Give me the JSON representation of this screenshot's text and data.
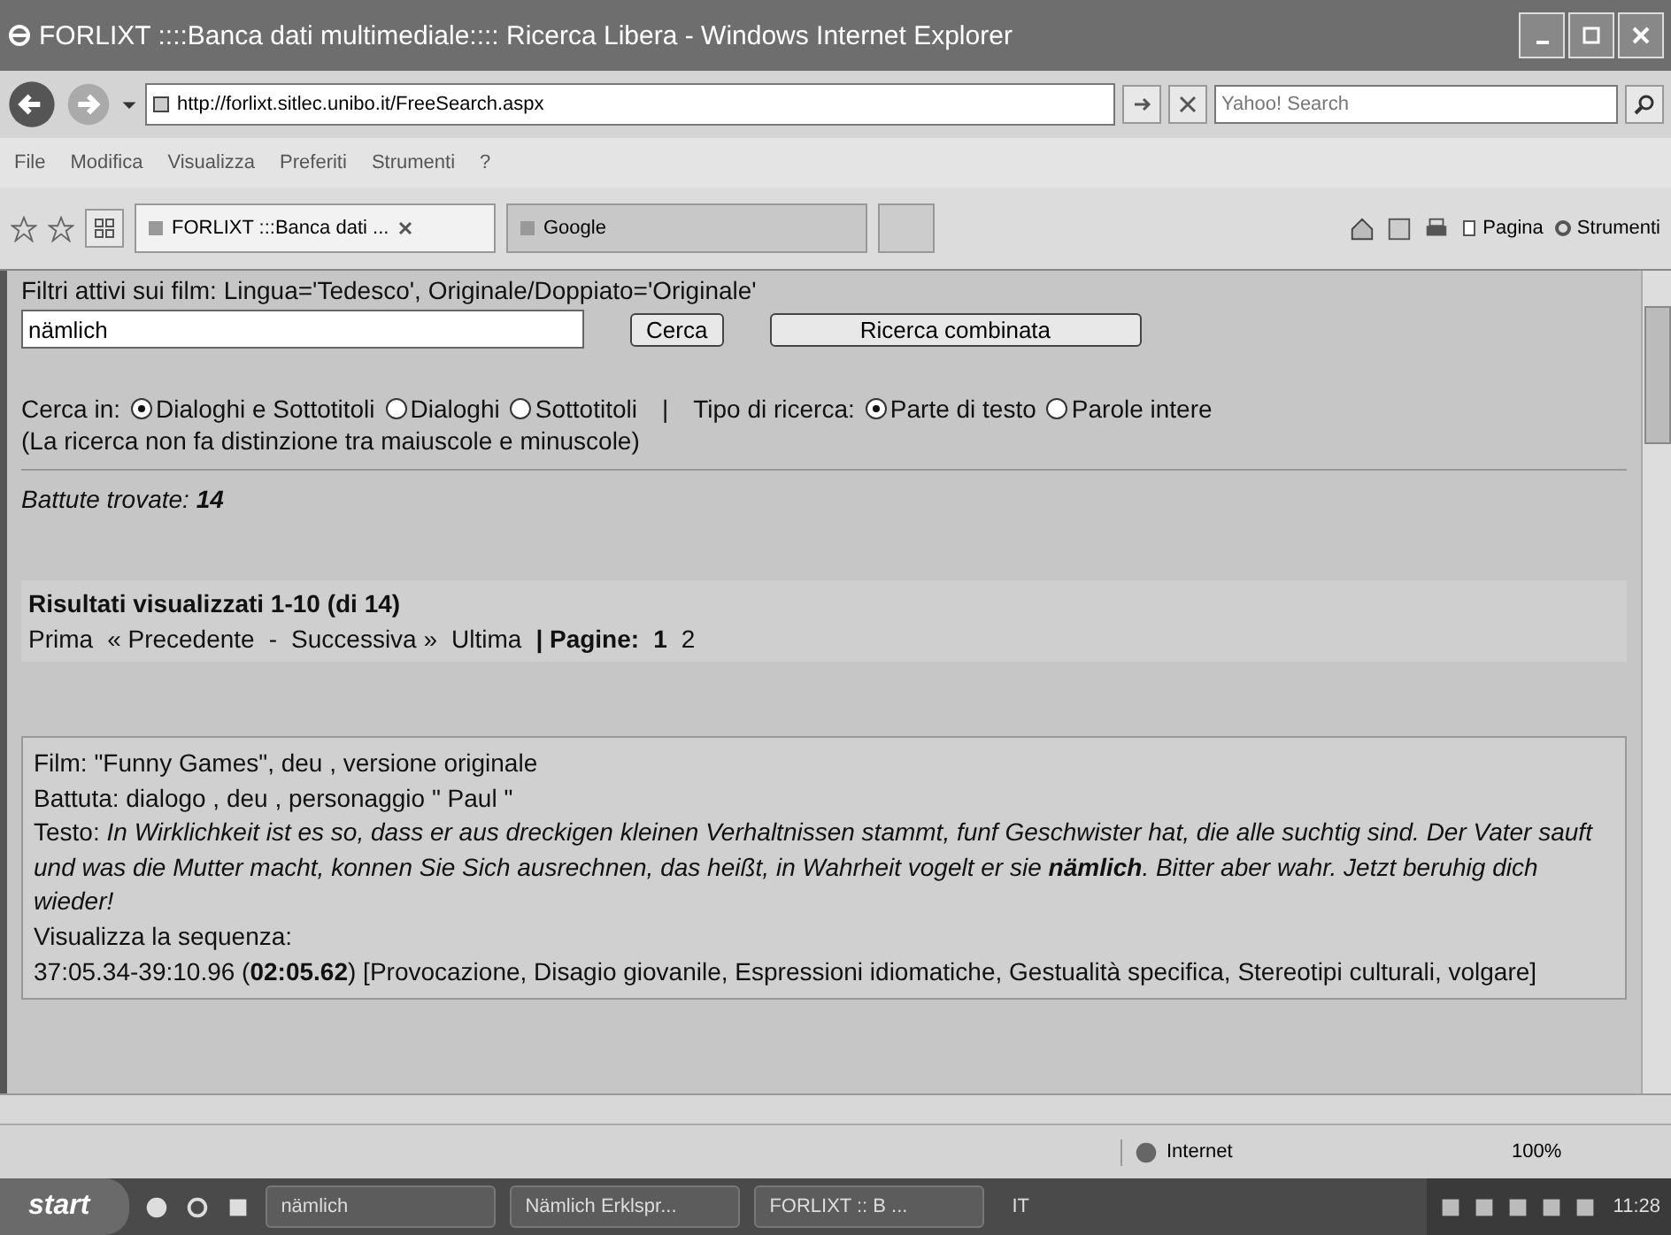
{
  "window": {
    "title": "FORLIXT ::::Banca dati multimediale:::: Ricerca Libera - Windows Internet Explorer"
  },
  "address_bar": {
    "url": "http://forlixt.sitlec.unibo.it/FreeSearch.aspx",
    "search_placeholder": "Yahoo! Search"
  },
  "menu": [
    "File",
    "Modifica",
    "Visualizza",
    "Preferiti",
    "Strumenti",
    "?"
  ],
  "tabs": [
    {
      "label": "FORLIXT :::Banca dati ...",
      "selected": true
    },
    {
      "label": "Google",
      "selected": false
    }
  ],
  "toolbar": {
    "page": "Pagina",
    "tools": "Strumenti"
  },
  "filters": "Filtri attivi sui film: Lingua='Tedesco', Originale/Doppiato='Originale'",
  "search": {
    "value": "nämlich",
    "button": "Cerca",
    "combined_button": "Ricerca combinata"
  },
  "options": [
    {
      "label": "Cerca in:",
      "choices": [
        {
          "label": "Dialoghi e Sottotitoli",
          "selected": true
        },
        {
          "label": "Dialoghi",
          "selected": false
        },
        {
          "label": "Sottotitoli",
          "selected": false
        }
      ]
    },
    {
      "label": "Tipo di ricerca:",
      "choices": [
        {
          "label": "Parte di testo",
          "selected": true
        },
        {
          "label": "Parole intere",
          "selected": false
        }
      ]
    }
  ],
  "separator": "|",
  "note": "(La ricerca non fa distinzione tra maiuscole e minuscole)",
  "found": {
    "label": "Battute trovate:",
    "count": "14"
  },
  "results_header": {
    "title": "Risultati visualizzati 1-10 (di 14)",
    "nav": [
      "Prima",
      "« Precedente",
      "-",
      "Successiva »",
      "Ultima"
    ],
    "pages_label": "| Pagine:",
    "pages": [
      {
        "label": "1",
        "selected": true
      },
      {
        "label": "2",
        "selected": false
      }
    ]
  },
  "result": {
    "film": "Film: \"Funny Games\", deu , versione originale",
    "battuta": "Battuta: dialogo , deu , personaggio \" Paul \"",
    "testo_label": "Testo:",
    "testo": "In Wirklichkeit ist es so, dass er aus dreckigen kleinen Verhaltnissen stammt, funf Geschwister hat, die alle suchtig sind. Der Vater sauft und was die Mutter macht, konnen Sie Sich ausrechnen, das heißt, in Wahrheit vogelt er sie **nämlich**. Bitter aber wahr. Jetzt beruhig dich wieder!",
    "sequence_link": "Visualizza la sequenza:",
    "timing": "37:05.34-39:10.96 (**02:05.62**) [Provocazione, Disagio giovanile, Espressioni idiomatiche, Gestualità specifica, Stereotipi culturali, volgare]"
  },
  "status_bar": {
    "zone": "Internet",
    "zoom": "100%"
  },
  "taskbar": {
    "start": "start",
    "items": [
      "nämlich",
      "Nämlich Erklspr...",
      "FORLIXT :: B ..."
    ],
    "language": "IT",
    "clock": "11:28"
  }
}
